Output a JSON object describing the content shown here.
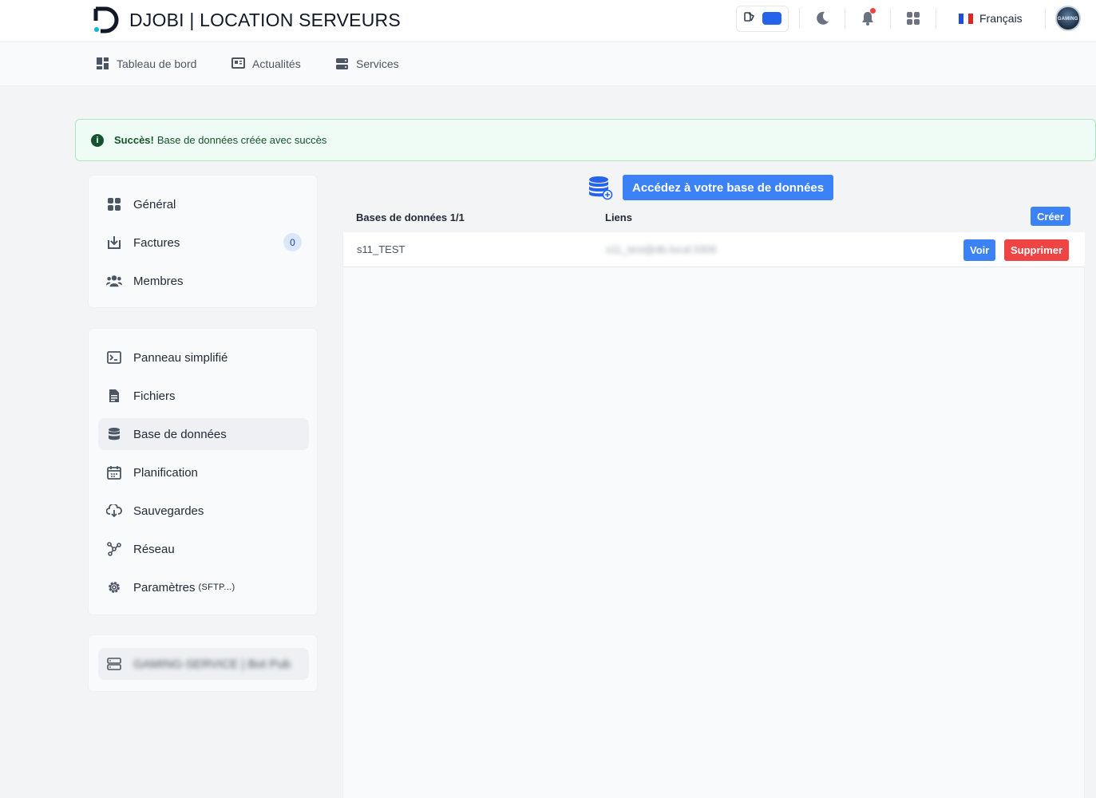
{
  "header": {
    "brand": "DJOBI | LOCATION SERVEURS",
    "language": "Français",
    "avatar_text": "GAMING",
    "accent_color": "#2563eb",
    "icons": [
      "theme-toggle-icon",
      "moon-icon",
      "bell-icon",
      "apps-grid-icon"
    ]
  },
  "subnav": {
    "items": [
      {
        "label": "Tableau de bord",
        "icon": "dashboard-icon"
      },
      {
        "label": "Actualités",
        "icon": "news-icon"
      },
      {
        "label": "Services",
        "icon": "server-icon"
      }
    ]
  },
  "alert": {
    "title": "Succès!",
    "message": "Base de données créée avec succès",
    "color": "#14532d"
  },
  "sidebar": {
    "group1": [
      {
        "label": "Général",
        "icon": "grid-icon"
      },
      {
        "label": "Factures",
        "icon": "invoice-download-icon",
        "badge": "0"
      },
      {
        "label": "Membres",
        "icon": "users-icon"
      }
    ],
    "group2": [
      {
        "label": "Panneau simplifié",
        "icon": "terminal-icon"
      },
      {
        "label": "Fichiers",
        "icon": "file-icon"
      },
      {
        "label": "Base de données",
        "icon": "database-icon",
        "active": true
      },
      {
        "label": "Planification",
        "icon": "calendar-icon"
      },
      {
        "label": "Sauvegardes",
        "icon": "cloud-download-icon"
      },
      {
        "label": "Réseau",
        "icon": "network-icon"
      },
      {
        "label": "Paramètres",
        "suffix": "(SFTP...)",
        "icon": "gear-icon"
      }
    ],
    "server": {
      "label": "GAMING-SERVICE | Bot Pub",
      "icon": "server-icon"
    }
  },
  "main": {
    "cta_label": "Accédez à votre base de données",
    "table": {
      "col_databases": "Bases de données 1/1",
      "col_links": "Liens",
      "create_label": "Créer",
      "rows": [
        {
          "name": "s11_TEST",
          "link": "s11_test@db.local:3306",
          "view_label": "Voir",
          "delete_label": "Supprimer"
        }
      ]
    }
  },
  "colors": {
    "primary": "#3b82f6",
    "danger": "#ef4444",
    "success_bg": "#effcf5"
  }
}
